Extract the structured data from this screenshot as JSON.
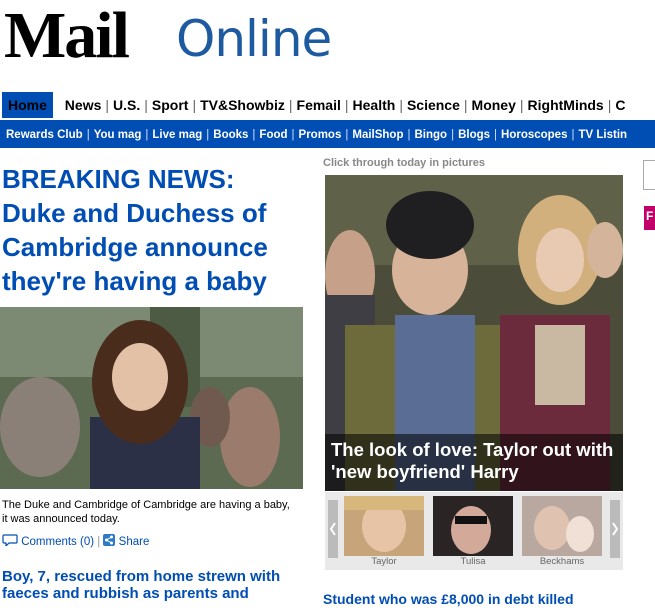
{
  "logo": {
    "mail": "Mail",
    "online": "Online"
  },
  "nav_primary": [
    "Home",
    "News",
    "U.S.",
    "Sport",
    "TV&Showbiz",
    "Femail",
    "Health",
    "Science",
    "Money",
    "RightMinds",
    "C"
  ],
  "nav_secondary": [
    "Rewards Club",
    "You mag",
    "Live mag",
    "Books",
    "Food",
    "Promos",
    "MailShop",
    "Bingo",
    "Blogs",
    "Horoscopes",
    "TV Listin"
  ],
  "breaking": {
    "prefix": "BREAKING NEWS:",
    "headline": "Duke and Duchess of Cambridge announce they're having a baby",
    "caption": "The Duke and Cambridge of Cambridge are having a baby, it was announced today.",
    "comments": "Comments (0)",
    "share": "Share"
  },
  "story2": {
    "headline": "Boy, 7, rescued from home strewn with faeces and rubbish as parents and"
  },
  "pictures": {
    "label": "Click through today in pictures",
    "caption": "The look of love: Taylor out with 'new boyfriend' Harry",
    "thumbs": [
      "Taylor",
      "Tulisa",
      "Beckhams"
    ]
  },
  "student": {
    "headline": "Student who was £8,000 in debt killed"
  },
  "sidebar": {
    "pink_label": "F"
  },
  "colors": {
    "brand_blue": "#004db3",
    "logo_blue": "#1e5aa0",
    "pink": "#c1006a"
  }
}
